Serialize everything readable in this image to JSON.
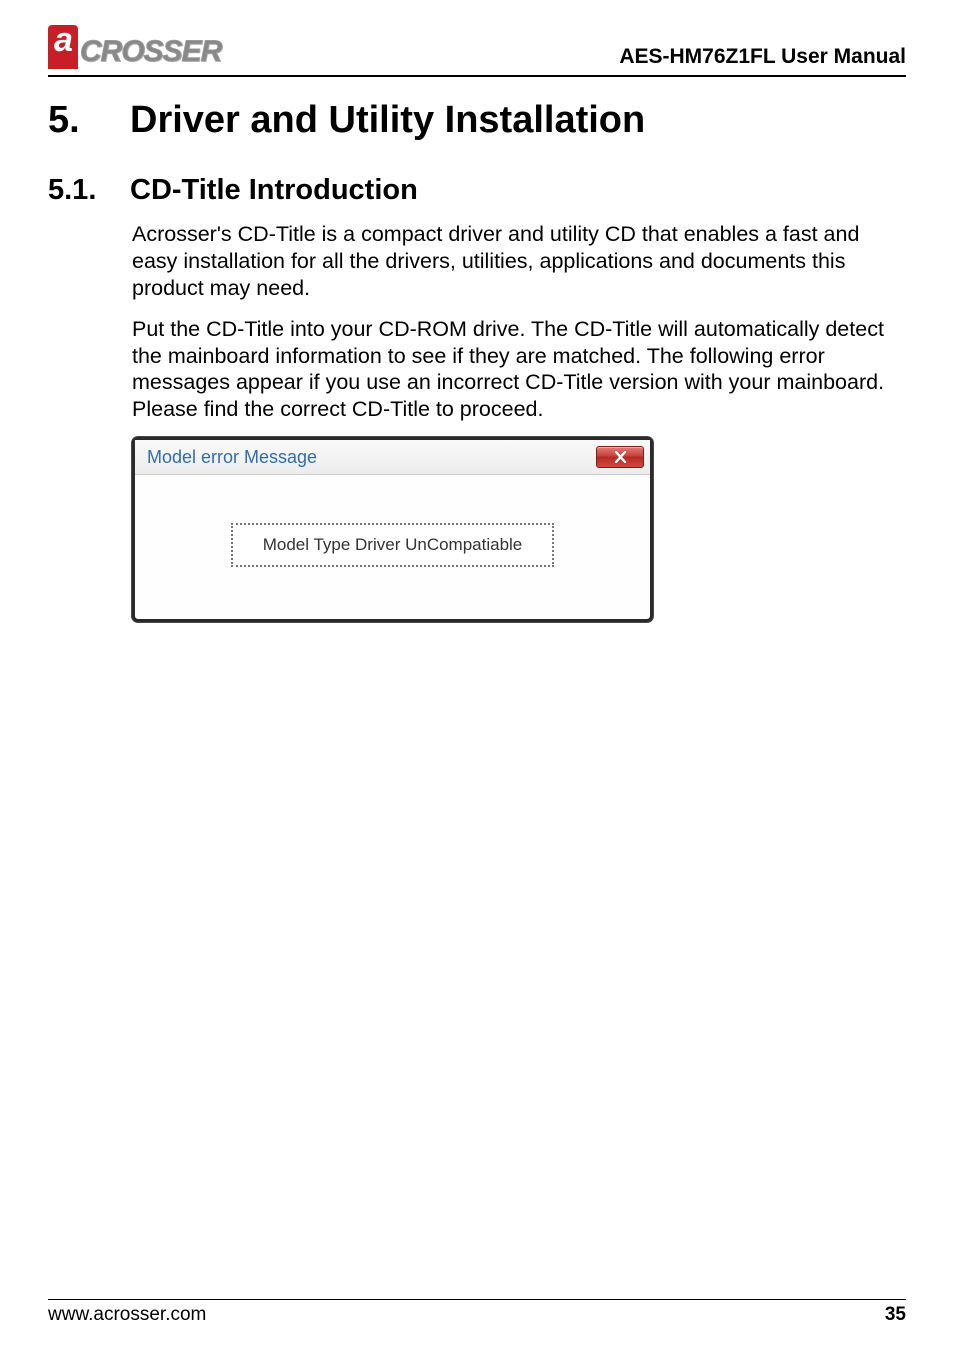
{
  "header": {
    "logo_text": "CROSSER",
    "doc_title": "AES-HM76Z1FL User Manual"
  },
  "chapter": {
    "number": "5.",
    "title": "Driver and Utility Installation"
  },
  "section": {
    "number": "5.1.",
    "title": "CD-Title Introduction",
    "para1": "Acrosser's CD-Title is a compact driver and utility CD that enables a fast and easy installation for all the drivers, utilities, applications and documents this product may need.",
    "para2": "Put the CD-Title into your CD-ROM drive. The CD-Title will automatically detect the mainboard information to see if they are matched. The following error messages appear if you use an incorrect CD-Title version with your mainboard. Please find the correct CD-Title to proceed."
  },
  "dialog": {
    "title": "Model error Message",
    "message": "Model Type Driver UnCompatiable"
  },
  "footer": {
    "url": "www.acrosser.com",
    "page": "35"
  }
}
